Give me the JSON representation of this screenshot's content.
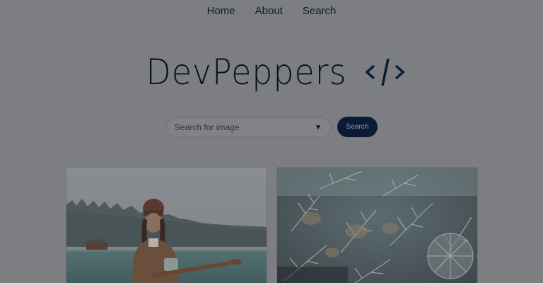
{
  "nav": {
    "items": [
      "Home",
      "About",
      "Search"
    ]
  },
  "brand": {
    "name": "DevPeppers",
    "code_icon": "code-brackets-icon"
  },
  "search": {
    "placeholder": "Search for image",
    "dropdown_icon": "triangle-down-icon",
    "button_label": "Search"
  },
  "colors": {
    "overlay_bg": "#7c7e82",
    "button_bg": "#0b1b37",
    "text_dark": "#0f1a2e"
  }
}
